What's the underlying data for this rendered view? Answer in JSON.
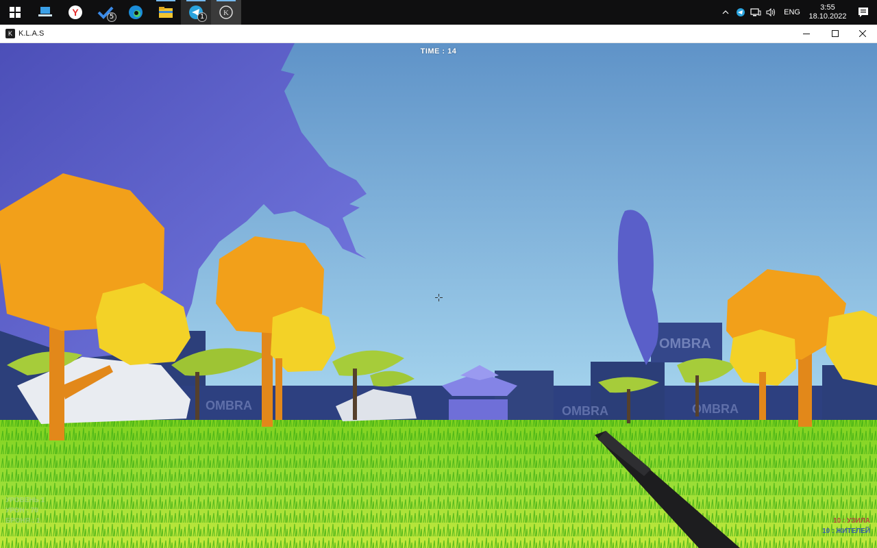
{
  "taskbar": {
    "apps": [
      {
        "name": "windows-start-icon"
      },
      {
        "name": "laptop-app-icon"
      },
      {
        "name": "yandex-browser-icon"
      },
      {
        "name": "todo-app-icon",
        "badge": "5"
      },
      {
        "name": "edge-browser-icon"
      },
      {
        "name": "file-explorer-icon"
      },
      {
        "name": "telegram-icon",
        "badge": "1"
      },
      {
        "name": "klas-game-icon"
      }
    ],
    "tray": {
      "language": "ENG",
      "time": "3:55",
      "date": "18.10.2022"
    }
  },
  "window": {
    "title": "K.L.A.S",
    "icon_letter": "K"
  },
  "hud": {
    "time": "TIME : 14",
    "stats": [
      "УРОВЕНЬ 1",
      "",
      "",
      "УРОН : 70",
      "БРОНЯ : 1"
    ],
    "right_stats": [
      {
        "text": "10 : УЗИЛА",
        "color": "#b44a3a"
      },
      {
        "text": "10 : ЖИТЕЛЕЙ",
        "color": "#3b5fa8"
      }
    ]
  },
  "scene": {
    "wall_text": "OMBRA",
    "colors": {
      "sky_top": "#5f93c8",
      "sky_bottom": "#a9d8f0",
      "grass": "#8fd62a",
      "blob": "#5a5fc9",
      "tree_orange": "#f2a01a",
      "tree_yellow": "#f3d227",
      "tree_green": "#a6cc3a",
      "wall": "#2c3f7a"
    }
  }
}
